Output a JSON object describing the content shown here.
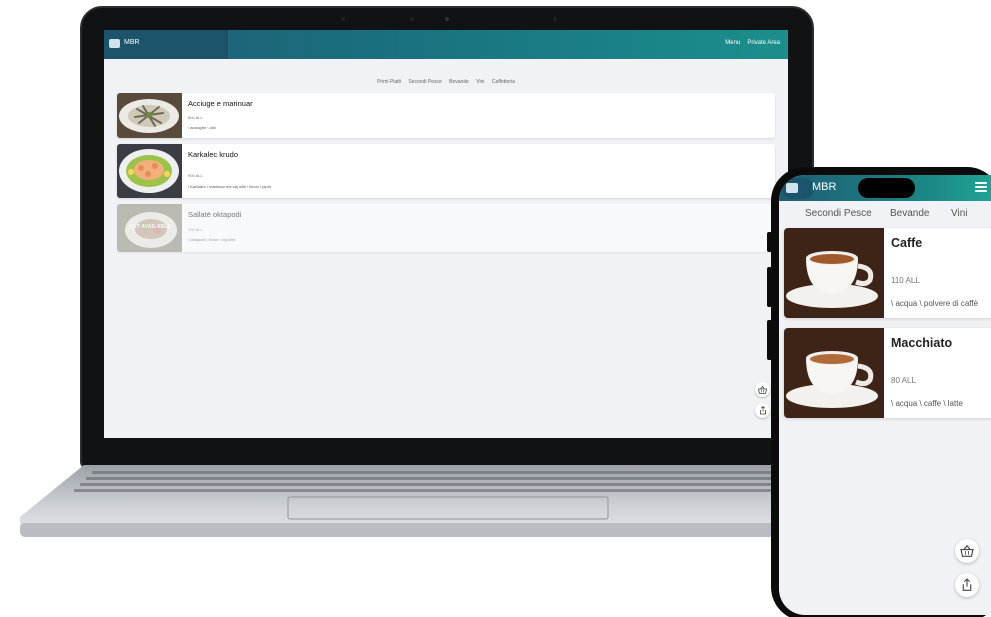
{
  "colors": {
    "header_start": "#1f5e74",
    "header_end": "#1b8f8c",
    "background": "#f1f2f6",
    "card": "#ffffff"
  },
  "laptop": {
    "header": {
      "brand": "MBR",
      "nav": [
        "Menu",
        "Private Area"
      ]
    },
    "categories": [
      "Primi Piatti",
      "Secondi Pesce",
      "Bevande",
      "Vini",
      "Caffetteria"
    ],
    "items": [
      {
        "name": "Acciuge e marinuar",
        "price": "600 ALL",
        "ingredients": "\\ acciughe \\ olio",
        "available": true,
        "image_icon": "anchovy-dish-photo"
      },
      {
        "name": "Karkalec krudo",
        "price": "900 ALL",
        "ingredients": "\\ Karkalec \\ marinuar me vaj ulliri \\ limon \\ piper",
        "available": true,
        "image_icon": "shrimp-dish-photo"
      },
      {
        "name": "Sallatë oktapodi",
        "price": "700 ALL",
        "ingredients": "\\ oktapodi \\ limon \\ vaj ulliri",
        "available": false,
        "unavailable_label": "NOT AVAILABLE",
        "image_icon": "octopus-salad-photo"
      }
    ],
    "fab_icons": [
      "basket-icon",
      "share-icon"
    ]
  },
  "phone": {
    "header": {
      "brand": "MBR"
    },
    "categories": [
      "Secondi Pesce",
      "Bevande",
      "Vini"
    ],
    "items": [
      {
        "name": "Caffe",
        "price": "110 ALL",
        "ingredients": "\\ acqua \\ polvere di caffè",
        "image_icon": "espresso-cup-photo"
      },
      {
        "name": "Macchiato",
        "price": "80 ALL",
        "ingredients": "\\ acqua \\ caffe \\ latte",
        "image_icon": "macchiato-cup-photo"
      }
    ],
    "fab_icons": [
      "basket-icon",
      "share-icon"
    ]
  }
}
